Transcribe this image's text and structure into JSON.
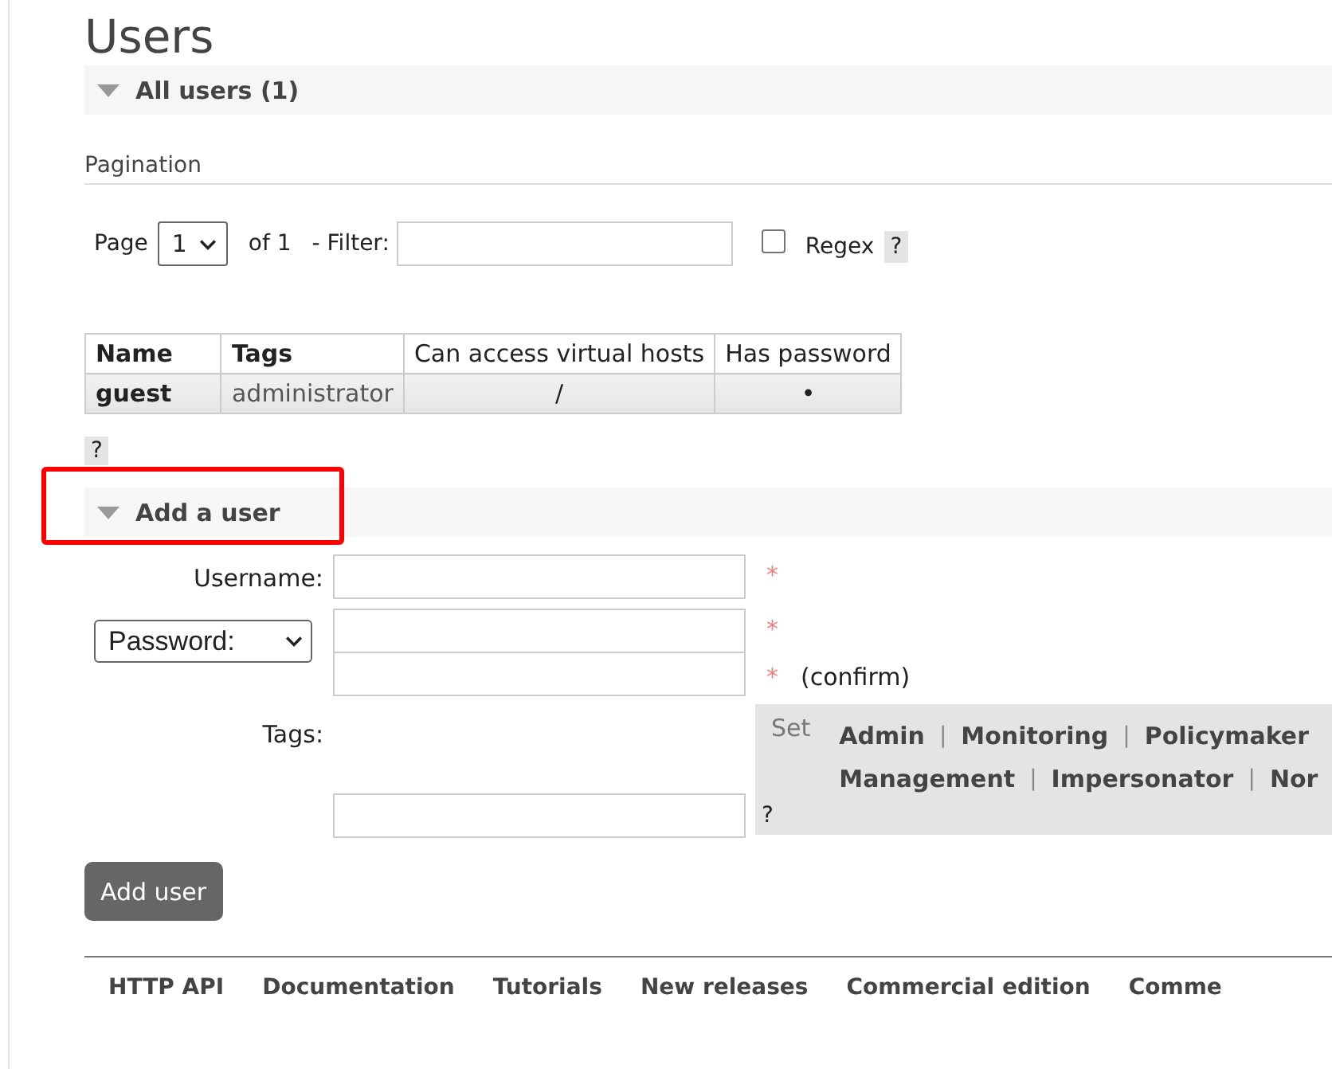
{
  "title": "Users",
  "all_users": {
    "heading": "All users (1)",
    "expanded": true,
    "pagination_label": "Pagination",
    "page_label": "Page",
    "page_value": "1",
    "of_label": "of 1",
    "filter_label": "- Filter:",
    "regex": {
      "label": "Regex",
      "checked": false
    },
    "help": "?",
    "table": {
      "columns": [
        "Name",
        "Tags",
        "Can access virtual hosts",
        "Has password"
      ],
      "rows": [
        [
          "guest",
          "administrator",
          "/",
          "•"
        ]
      ]
    },
    "table_help": "?"
  },
  "add_user": {
    "heading": "Add a user",
    "expanded": true,
    "highlighted": true,
    "username_label": "Username:",
    "required": "*",
    "password_select": "Password:",
    "confirm": "(confirm)",
    "tags_label": "Tags:",
    "set_label": "Set",
    "tag_options": [
      [
        "Admin",
        "Monitoring",
        "Policymaker"
      ],
      [
        "Management",
        "Impersonator",
        "Nor"
      ]
    ],
    "separator": "|",
    "tags_help": "?",
    "button": "Add user"
  },
  "footer_links": [
    "HTTP API",
    "Documentation",
    "Tutorials",
    "New releases",
    "Commercial edition",
    "Comme"
  ]
}
